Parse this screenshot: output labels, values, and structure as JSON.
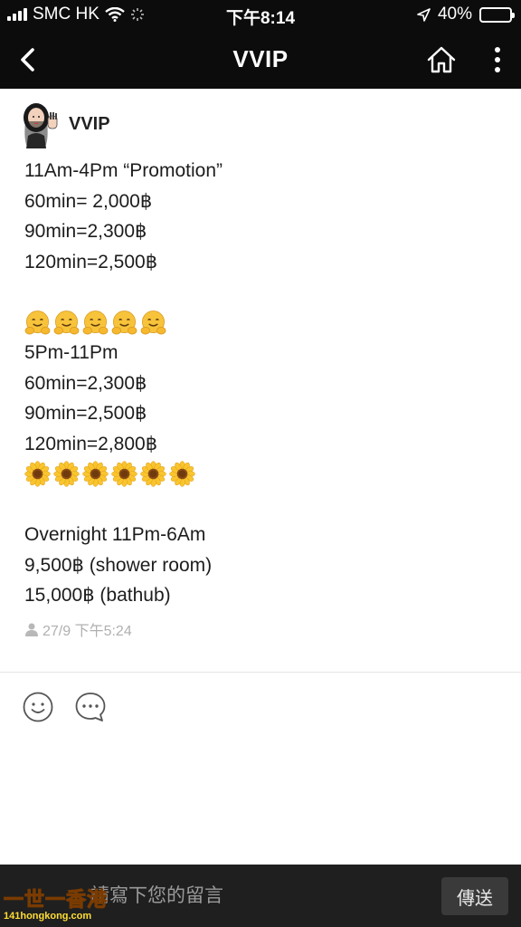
{
  "status_bar": {
    "carrier": "SMC HK",
    "time": "下午8:14",
    "battery_percent": "40%",
    "battery_level": 0.4
  },
  "nav": {
    "title": "VVIP",
    "back_icon": "chevron-left-icon",
    "home_icon": "home-icon",
    "more_icon": "more-vertical-icon"
  },
  "post": {
    "author": "VVIP",
    "lines": [
      "11Am-4Pm “Promotion”",
      "60min= 2,000฿",
      "90min=2,300฿",
      "120min=2,500฿",
      "",
      "",
      "5Pm-11Pm",
      "60min=2,300฿",
      "90min=2,500฿",
      "120min=2,800฿",
      "",
      "",
      "Overnight 11Pm-6Am",
      "9,500฿ (shower room)",
      "15,000฿ (bathub)"
    ],
    "emoji_rows": {
      "hugging_faces": 5,
      "sunflowers": 6
    },
    "timestamp": "27/9 下午5:24"
  },
  "actions": {
    "smile_icon": "smile-icon",
    "comment_icon": "comment-icon"
  },
  "comment_bar": {
    "placeholder": "請寫下您的留言",
    "send_label": "傳送"
  },
  "watermark": {
    "top": "一世一香港",
    "bottom": "141hongkong.com"
  },
  "colors": {
    "header_bg": "#0c0c0c",
    "bottom_bar_bg": "#1f1f1f",
    "text": "#1d1d1d",
    "meta": "#b0b0b0"
  }
}
